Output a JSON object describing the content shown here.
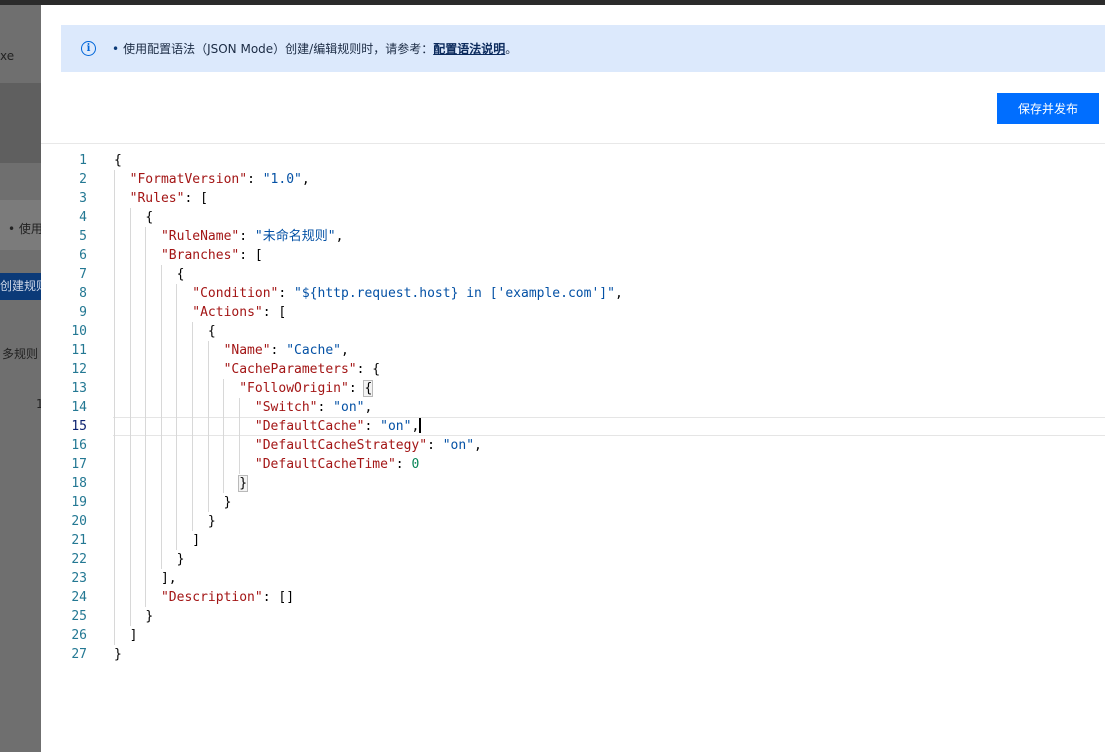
{
  "background": {
    "fragments": [
      "xe",
      "• 使用",
      "创建规则",
      "多规则",
      "1"
    ]
  },
  "notice": {
    "bullet": "•",
    "text": "使用配置语法（JSON Mode）创建/编辑规则时，请参考：",
    "link": "配置语法说明",
    "end": "。"
  },
  "save_button": "保存并发布",
  "editor": {
    "active_line": 15,
    "lines": [
      {
        "n": "1",
        "i": 0,
        "t": [
          [
            "p",
            "{"
          ]
        ]
      },
      {
        "n": "2",
        "i": 1,
        "t": [
          [
            "k",
            "\"FormatVersion\""
          ],
          [
            "p",
            ": "
          ],
          [
            "s",
            "\"1.0\""
          ],
          [
            "p",
            ","
          ]
        ]
      },
      {
        "n": "3",
        "i": 1,
        "t": [
          [
            "k",
            "\"Rules\""
          ],
          [
            "p",
            ": ["
          ]
        ]
      },
      {
        "n": "4",
        "i": 2,
        "t": [
          [
            "p",
            "{"
          ]
        ]
      },
      {
        "n": "5",
        "i": 3,
        "t": [
          [
            "k",
            "\"RuleName\""
          ],
          [
            "p",
            ": "
          ],
          [
            "s",
            "\"未命名规则\""
          ],
          [
            "p",
            ","
          ]
        ]
      },
      {
        "n": "6",
        "i": 3,
        "t": [
          [
            "k",
            "\"Branches\""
          ],
          [
            "p",
            ": ["
          ]
        ]
      },
      {
        "n": "7",
        "i": 4,
        "t": [
          [
            "p",
            "{"
          ]
        ]
      },
      {
        "n": "8",
        "i": 5,
        "t": [
          [
            "k",
            "\"Condition\""
          ],
          [
            "p",
            ": "
          ],
          [
            "s",
            "\"${http.request.host} in ['example.com']\""
          ],
          [
            "p",
            ","
          ]
        ]
      },
      {
        "n": "9",
        "i": 5,
        "t": [
          [
            "k",
            "\"Actions\""
          ],
          [
            "p",
            ": ["
          ]
        ]
      },
      {
        "n": "10",
        "i": 6,
        "t": [
          [
            "p",
            "{"
          ]
        ]
      },
      {
        "n": "11",
        "i": 7,
        "t": [
          [
            "k",
            "\"Name\""
          ],
          [
            "p",
            ": "
          ],
          [
            "s",
            "\"Cache\""
          ],
          [
            "p",
            ","
          ]
        ]
      },
      {
        "n": "12",
        "i": 7,
        "t": [
          [
            "k",
            "\"CacheParameters\""
          ],
          [
            "p",
            ": {"
          ]
        ]
      },
      {
        "n": "13",
        "i": 8,
        "t": [
          [
            "k",
            "\"FollowOrigin\""
          ],
          [
            "p",
            ": "
          ],
          [
            "bm",
            "{"
          ]
        ]
      },
      {
        "n": "14",
        "i": 9,
        "t": [
          [
            "k",
            "\"Switch\""
          ],
          [
            "p",
            ": "
          ],
          [
            "s",
            "\"on\""
          ],
          [
            "p",
            ","
          ]
        ]
      },
      {
        "n": "15",
        "i": 9,
        "t": [
          [
            "k",
            "\"DefaultCache\""
          ],
          [
            "p",
            ": "
          ],
          [
            "s",
            "\"on\""
          ],
          [
            "p",
            ","
          ],
          [
            "cursor",
            ""
          ]
        ]
      },
      {
        "n": "16",
        "i": 9,
        "t": [
          [
            "k",
            "\"DefaultCacheStrategy\""
          ],
          [
            "p",
            ": "
          ],
          [
            "s",
            "\"on\""
          ],
          [
            "p",
            ","
          ]
        ]
      },
      {
        "n": "17",
        "i": 9,
        "t": [
          [
            "k",
            "\"DefaultCacheTime\""
          ],
          [
            "p",
            ": "
          ],
          [
            "n",
            "0"
          ]
        ]
      },
      {
        "n": "18",
        "i": 8,
        "t": [
          [
            "bm",
            "}"
          ]
        ]
      },
      {
        "n": "19",
        "i": 7,
        "t": [
          [
            "p",
            "}"
          ]
        ]
      },
      {
        "n": "20",
        "i": 6,
        "t": [
          [
            "p",
            "}"
          ]
        ]
      },
      {
        "n": "21",
        "i": 5,
        "t": [
          [
            "p",
            "]"
          ]
        ]
      },
      {
        "n": "22",
        "i": 4,
        "t": [
          [
            "p",
            "}"
          ]
        ]
      },
      {
        "n": "23",
        "i": 3,
        "t": [
          [
            "p",
            "],"
          ]
        ]
      },
      {
        "n": "24",
        "i": 3,
        "t": [
          [
            "k",
            "\"Description\""
          ],
          [
            "p",
            ": []"
          ]
        ]
      },
      {
        "n": "25",
        "i": 2,
        "t": [
          [
            "p",
            "}"
          ]
        ]
      },
      {
        "n": "26",
        "i": 1,
        "t": [
          [
            "p",
            "]"
          ]
        ]
      },
      {
        "n": "27",
        "i": 0,
        "t": [
          [
            "p",
            "}"
          ]
        ]
      }
    ]
  }
}
